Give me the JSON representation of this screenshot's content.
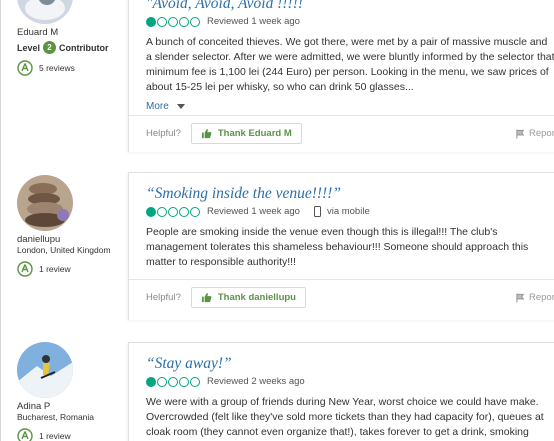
{
  "reviews": [
    {
      "user": {
        "name": "Eduard M",
        "location": "",
        "level_label": "Level",
        "level": "2",
        "level_suffix": "Contributor",
        "review_count": "5 reviews"
      },
      "title": "\"Avoid, Avoid, Avoid !!!!!",
      "rating": 1,
      "date": "Reviewed 1 week ago",
      "body": "A bunch of conceited thieves. We got there, were met by a pair of massive muscle and a slender selector. After we were admitted, we were bluntly informed by the selector that minimum fee is 1,100 lei (244 Euro) per person. Looking in the menu, we saw prices of about 15-25 lei per whisky, so who can drink 50 glasses...",
      "more": "More",
      "helpful": "Helpful?",
      "thank": "Thank Eduard M",
      "report": "Report"
    },
    {
      "user": {
        "name": "daniellupu",
        "location": "London, United Kingdom",
        "review_count": "1 review"
      },
      "title": "“Smoking inside the venue!!!!”",
      "rating": 1,
      "date": "Reviewed 1 week ago",
      "via": "via mobile",
      "body": "People are smoking inside the venue even though this is illegal!!! The club's management tolerates this shameless behaviour!!! Someone should approach this matter to responsible authority!!!",
      "helpful": "Helpful?",
      "thank": "Thank daniellupu",
      "report": "Report"
    },
    {
      "user": {
        "name": "Adina P",
        "location": "Bucharest, Romania",
        "review_count": "1 review"
      },
      "title": "“Stay away!”",
      "rating": 1,
      "date": "Reviewed 2 weeks ago",
      "body": "We were with a group of friends during New Year, worst choice we could have make. Overcrowded (felt like they've sold more tickets than they had capacity for), queues at cloak room (they cannot even organize that!), takes forever to get a drink, smoking"
    }
  ],
  "colors": {
    "accent": "#00a680",
    "title": "#2c6fa6",
    "thank": "#589442"
  }
}
